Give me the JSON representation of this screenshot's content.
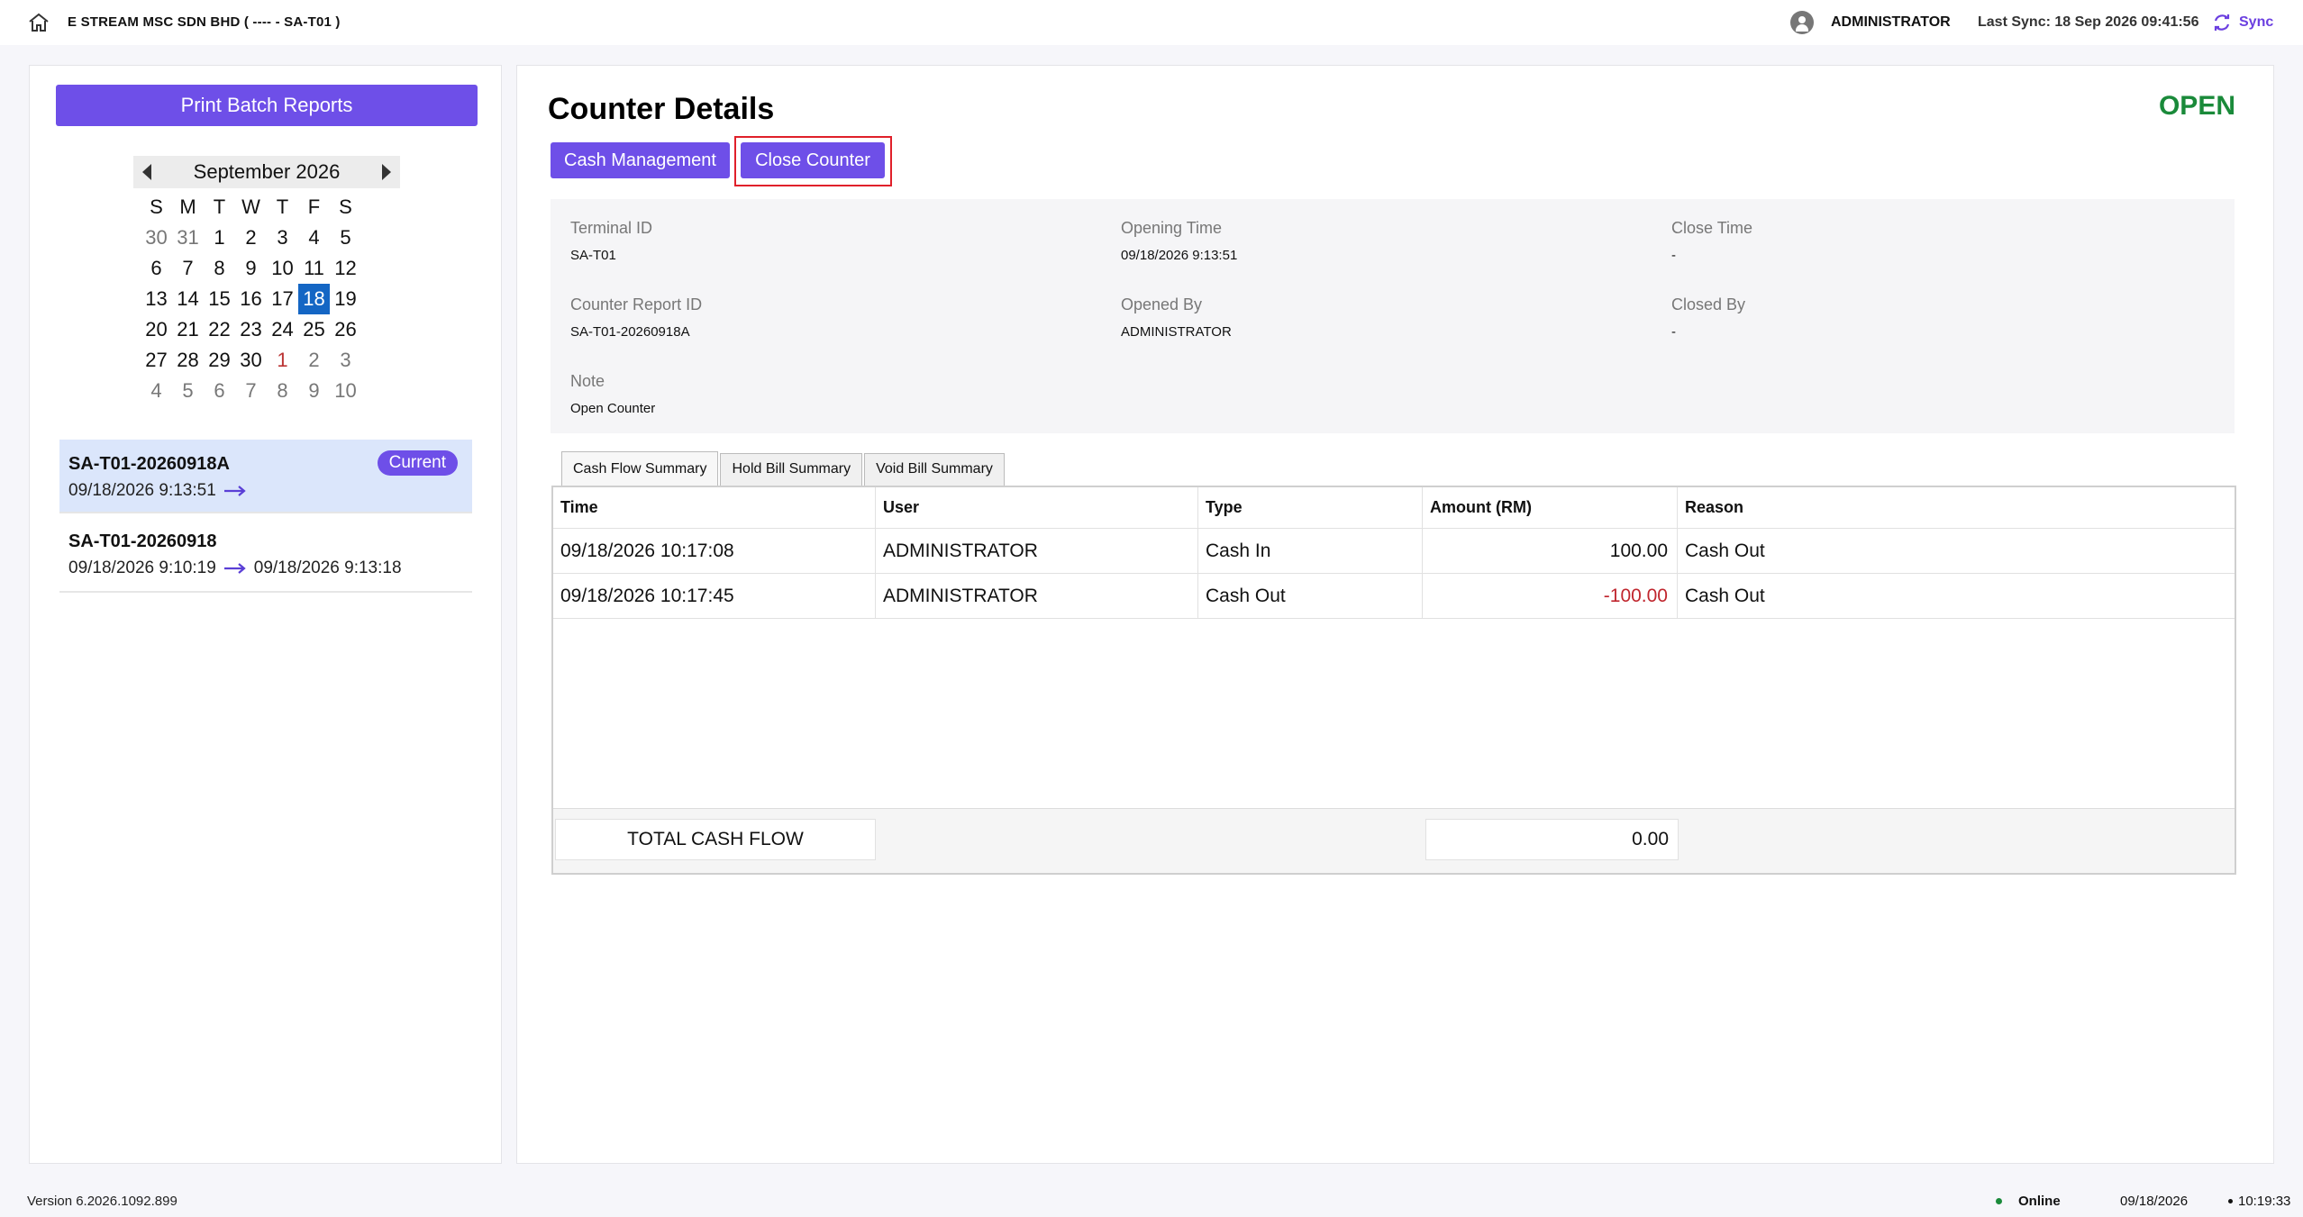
{
  "header": {
    "company": "E STREAM MSC SDN BHD ( ---- - SA-T01 )",
    "user": "ADMINISTRATOR",
    "last_sync": "Last Sync: 18 Sep 2026 09:41:56",
    "sync_label": "Sync"
  },
  "sidebar": {
    "print_label": "Print Batch Reports",
    "calendar": {
      "title": "September 2026",
      "dow": [
        "S",
        "M",
        "T",
        "W",
        "T",
        "F",
        "S"
      ],
      "weeks": [
        [
          "30",
          "31",
          "1",
          "2",
          "3",
          "4",
          "5"
        ],
        [
          "6",
          "7",
          "8",
          "9",
          "10",
          "11",
          "12"
        ],
        [
          "13",
          "14",
          "15",
          "16",
          "17",
          "18",
          "19"
        ],
        [
          "20",
          "21",
          "22",
          "23",
          "24",
          "25",
          "26"
        ],
        [
          "27",
          "28",
          "29",
          "30",
          "1",
          "2",
          "3"
        ],
        [
          "4",
          "5",
          "6",
          "7",
          "8",
          "9",
          "10"
        ]
      ],
      "selected": "18"
    },
    "sessions": [
      {
        "id": "SA-T01-20260918A",
        "badge": "Current",
        "start": "09/18/2026 9:13:51",
        "end": ""
      },
      {
        "id": "SA-T01-20260918",
        "badge": "",
        "start": "09/18/2026 9:10:19",
        "end": "09/18/2026 9:13:18"
      }
    ]
  },
  "main": {
    "title": "Counter Details",
    "status": "OPEN",
    "status_color": "#1a8a3a",
    "accent_color": "#6e4fe8",
    "buttons": {
      "cash_management": "Cash Management",
      "close_counter": "Close Counter"
    },
    "info": {
      "terminal_id_label": "Terminal ID",
      "terminal_id": "SA-T01",
      "opening_time_label": "Opening Time",
      "opening_time": "09/18/2026 9:13:51",
      "close_time_label": "Close Time",
      "close_time": "-",
      "report_id_label": "Counter Report ID",
      "report_id": "SA-T01-20260918A",
      "opened_by_label": "Opened By",
      "opened_by": "ADMINISTRATOR",
      "closed_by_label": "Closed By",
      "closed_by": "-",
      "note_label": "Note",
      "note": "Open Counter"
    },
    "tabs": [
      "Cash Flow Summary",
      "Hold Bill Summary",
      "Void Bill Summary"
    ],
    "table": {
      "headers": [
        "Time",
        "User",
        "Type",
        "Amount (RM)",
        "Reason"
      ],
      "rows": [
        [
          "09/18/2026 10:17:08",
          "ADMINISTRATOR",
          "Cash In",
          "100.00",
          "Cash Out"
        ],
        [
          "09/18/2026 10:17:45",
          "ADMINISTRATOR",
          "Cash Out",
          "-100.00",
          "Cash Out"
        ]
      ],
      "total_label": "TOTAL CASH FLOW",
      "total_value": "0.00"
    }
  },
  "statusbar": {
    "version": "Version 6.2026.1092.899",
    "online": "Online",
    "date": "09/18/2026",
    "time": "10:19:33"
  }
}
